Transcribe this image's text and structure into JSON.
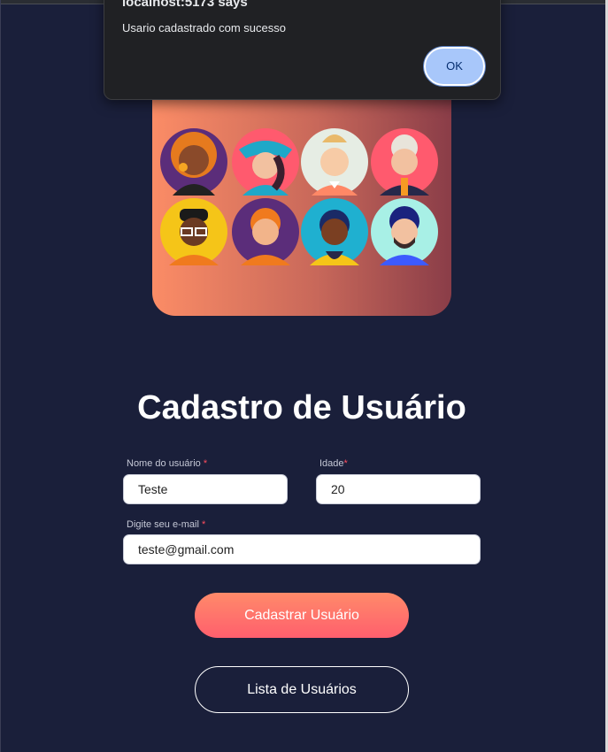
{
  "dialog": {
    "title": "localhost:5173 says",
    "message": "Usario cadastrado com sucesso",
    "ok_label": "OK"
  },
  "hero": {
    "icon": "user-avatars-illustration"
  },
  "form": {
    "title": "Cadastro de Usuário",
    "name_label": "Nome do usuário",
    "name_value": "Teste",
    "age_label": "Idade",
    "age_value": "20",
    "email_label": "Digite seu e-mail",
    "email_value": "teste@gmail.com",
    "required_mark": "*",
    "submit_label": "Cadastrar Usuário",
    "list_label": "Lista de Usuários"
  },
  "colors": {
    "background": "#1a1f3a",
    "accent": "#ff6b6b",
    "dialog_bg": "#202124",
    "ok_button": "#a8c7fa"
  }
}
